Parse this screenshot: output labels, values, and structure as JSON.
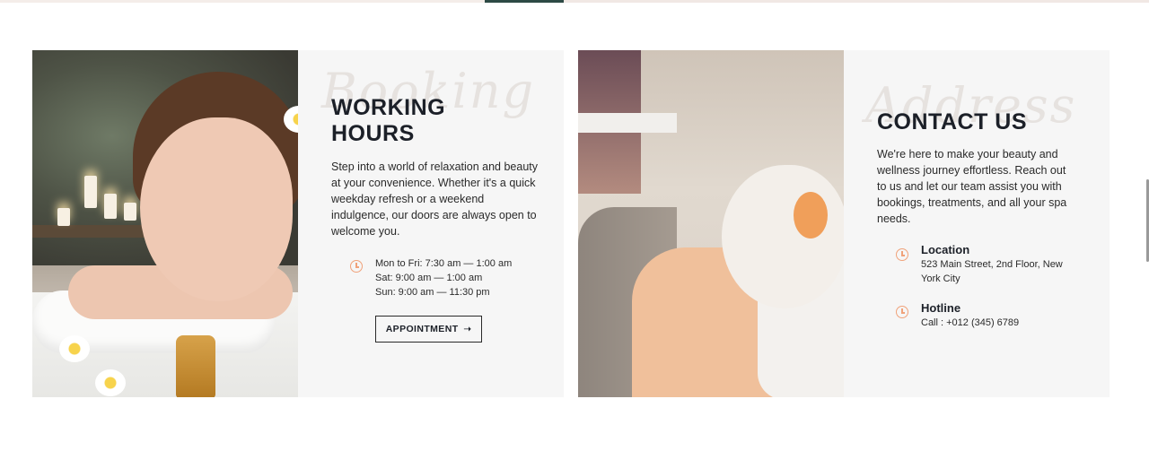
{
  "working_hours": {
    "watermark": "Booking",
    "title_line1": "WORKING",
    "title_line2": "HOURS",
    "description": "Step into a world of relaxation and beauty at your convenience. Whether it's a quick weekday refresh or a weekend indulgence, our doors are always open to welcome you.",
    "schedule": [
      "Mon to Fri: 7:30 am — 1:00 am",
      "Sat: 9:00 am — 1:00 am",
      "Sun: 9:00 am — 11:30 pm"
    ],
    "button_label": "APPOINTMENT",
    "button_icon": "arrow-right-icon"
  },
  "contact": {
    "watermark": "Address",
    "title": "CONTACT US",
    "description": "We're here to make your beauty and wellness journey effortless. Reach out to us and let our team assist you with bookings, treatments, and all your spa needs.",
    "location_title": "Location",
    "location_text": "523 Main Street, 2nd Floor, New York City",
    "hotline_title": "Hotline",
    "hotline_text": "Call : +012 (345) 6789"
  },
  "colors": {
    "accent": "#f0a27a",
    "panel_bg": "#f6f6f6",
    "heading": "#1c2028"
  }
}
